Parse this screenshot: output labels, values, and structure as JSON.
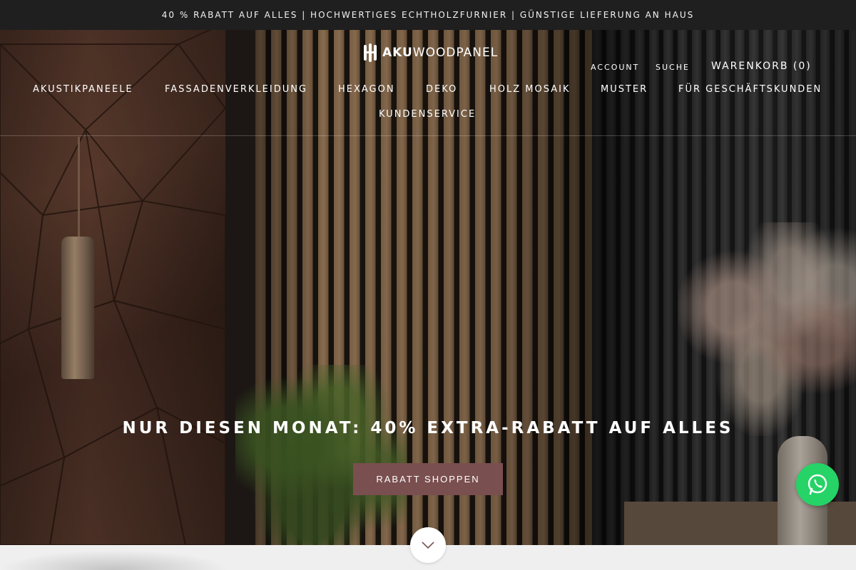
{
  "announcement": "40 % RABATT AUF ALLES | HOCHWERTIGES ECHTHOLZFURNIER | GÜNSTIGE LIEFERUNG AN HAUS",
  "logo": {
    "bold": "AKU",
    "light": "WOODPANEL"
  },
  "utility": {
    "account": "ACCOUNT",
    "search": "SUCHE",
    "cart": "WARENKORB (0)"
  },
  "nav": [
    "AKUSTIKPANEELE",
    "FASSADENVERKLEIDUNG",
    "HEXAGON",
    "DEKO",
    "HOLZ MOSAIK",
    "MUSTER",
    "FÜR GESCHÄFTSKUNDEN",
    "KUNDENSERVICE"
  ],
  "hero": {
    "headline": "NUR DIESEN MONAT: 40% EXTRA-RABATT AUF ALLES",
    "cta": "RABATT SHOPPEN"
  },
  "icons": {
    "scroll": "chevron-down-icon",
    "chat": "whatsapp-icon"
  },
  "colors": {
    "cta_bg": "#7a4f4f",
    "announcement_bg": "#1f1f1f",
    "whatsapp": "#25d366"
  }
}
